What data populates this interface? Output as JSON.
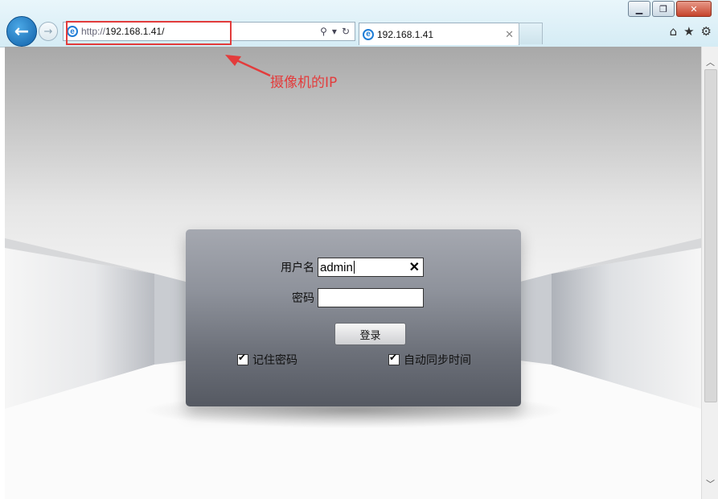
{
  "window": {
    "minimize_glyph": "▁",
    "restore_glyph": "❐",
    "close_glyph": "✕"
  },
  "nav": {
    "back_glyph": "←",
    "forward_glyph": "→"
  },
  "address_bar": {
    "protocol": "http://",
    "host": "192.168.1.41/",
    "search_icon": "⚲",
    "dropdown_icon": "▾",
    "refresh_icon": "↻"
  },
  "tab": {
    "title": "192.168.1.41",
    "close_glyph": "✕"
  },
  "toolbar_icons": {
    "home": "⌂",
    "favorites": "★",
    "settings": "⚙"
  },
  "annotation": {
    "text": "摄像机的IP",
    "color": "#e33c3c"
  },
  "login": {
    "username_label": "用户名",
    "username_value": "admin",
    "clear_glyph": "✕",
    "password_label": "密码",
    "password_value": "",
    "submit_label": "登录",
    "remember_label": "记住密码",
    "remember_checked": true,
    "sync_time_label": "自动同步时间",
    "sync_time_checked": true
  },
  "scrollbar": {
    "up_glyph": "︿",
    "down_glyph": "﹀"
  }
}
